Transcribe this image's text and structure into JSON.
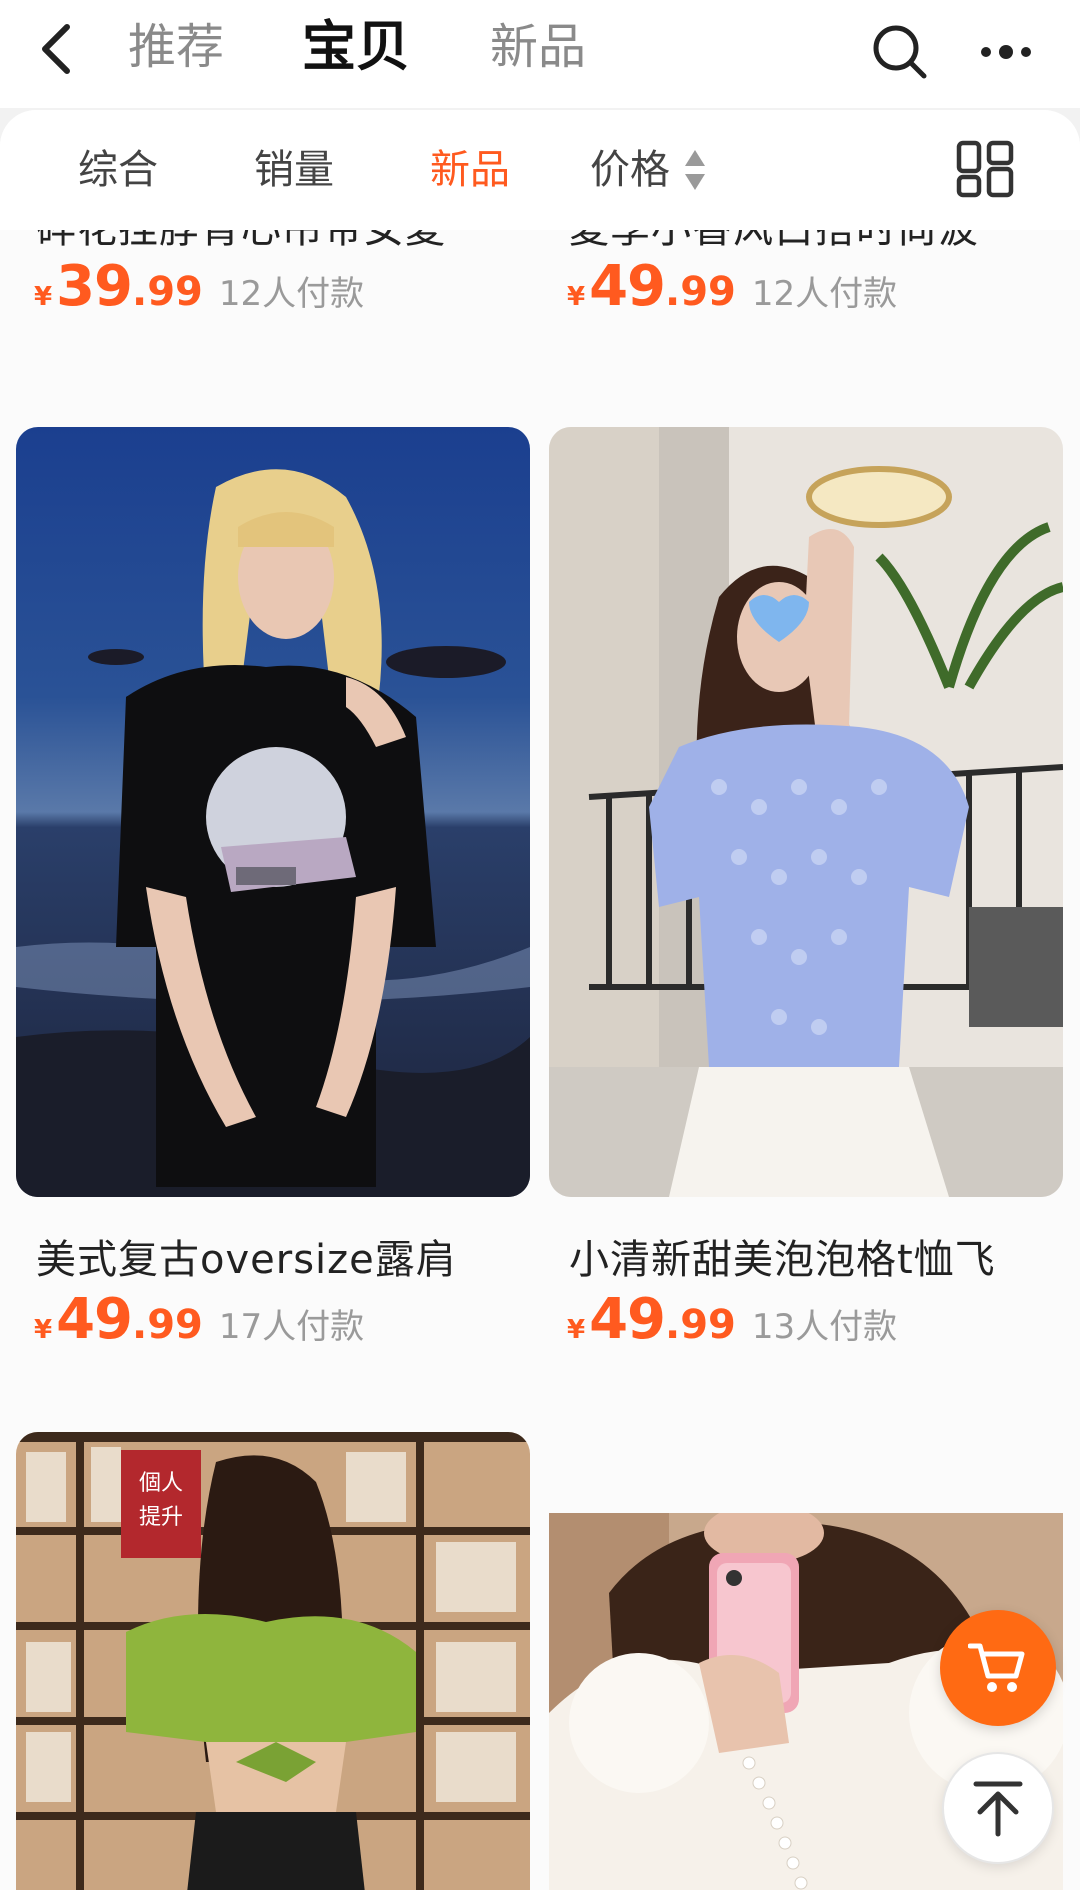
{
  "header": {
    "back_icon": "chevron-left-icon",
    "tabs": [
      {
        "label": "推荐",
        "active": false
      },
      {
        "label": "宝贝",
        "active": true
      },
      {
        "label": "新品",
        "active": false
      }
    ],
    "search_icon": "search-icon",
    "more_icon": "more-dots-icon"
  },
  "sort_bar": {
    "items": [
      {
        "label": "综合",
        "active": false
      },
      {
        "label": "销量",
        "active": false
      },
      {
        "label": "新品",
        "active": true
      },
      {
        "label": "价格",
        "active": false
      }
    ],
    "price_sort_icon": "sort-up-down-icon",
    "view_toggle_icon": "grid-view-icon"
  },
  "accent_color": "#ff5a1f",
  "products": [
    {
      "title": "碎花挂脖背心吊带女夏",
      "currency": "¥",
      "price_int": "39",
      "price_dec": ".99",
      "sold": "12人付款"
    },
    {
      "title": "夏季小香风白搭时尚波",
      "currency": "¥",
      "price_int": "49",
      "price_dec": ".99",
      "sold": "12人付款"
    },
    {
      "title": "美式复古oversize露肩",
      "currency": "¥",
      "price_int": "49",
      "price_dec": ".99",
      "sold": "17人付款"
    },
    {
      "title": "小清新甜美泡泡格t恤飞",
      "currency": "¥",
      "price_int": "49",
      "price_dec": ".99",
      "sold": "13人付款"
    }
  ],
  "image_badges": {
    "bookstore_sign": "個人提升"
  },
  "floating": {
    "cart_icon": "shopping-cart-icon",
    "back_to_top_icon": "back-to-top-icon"
  }
}
